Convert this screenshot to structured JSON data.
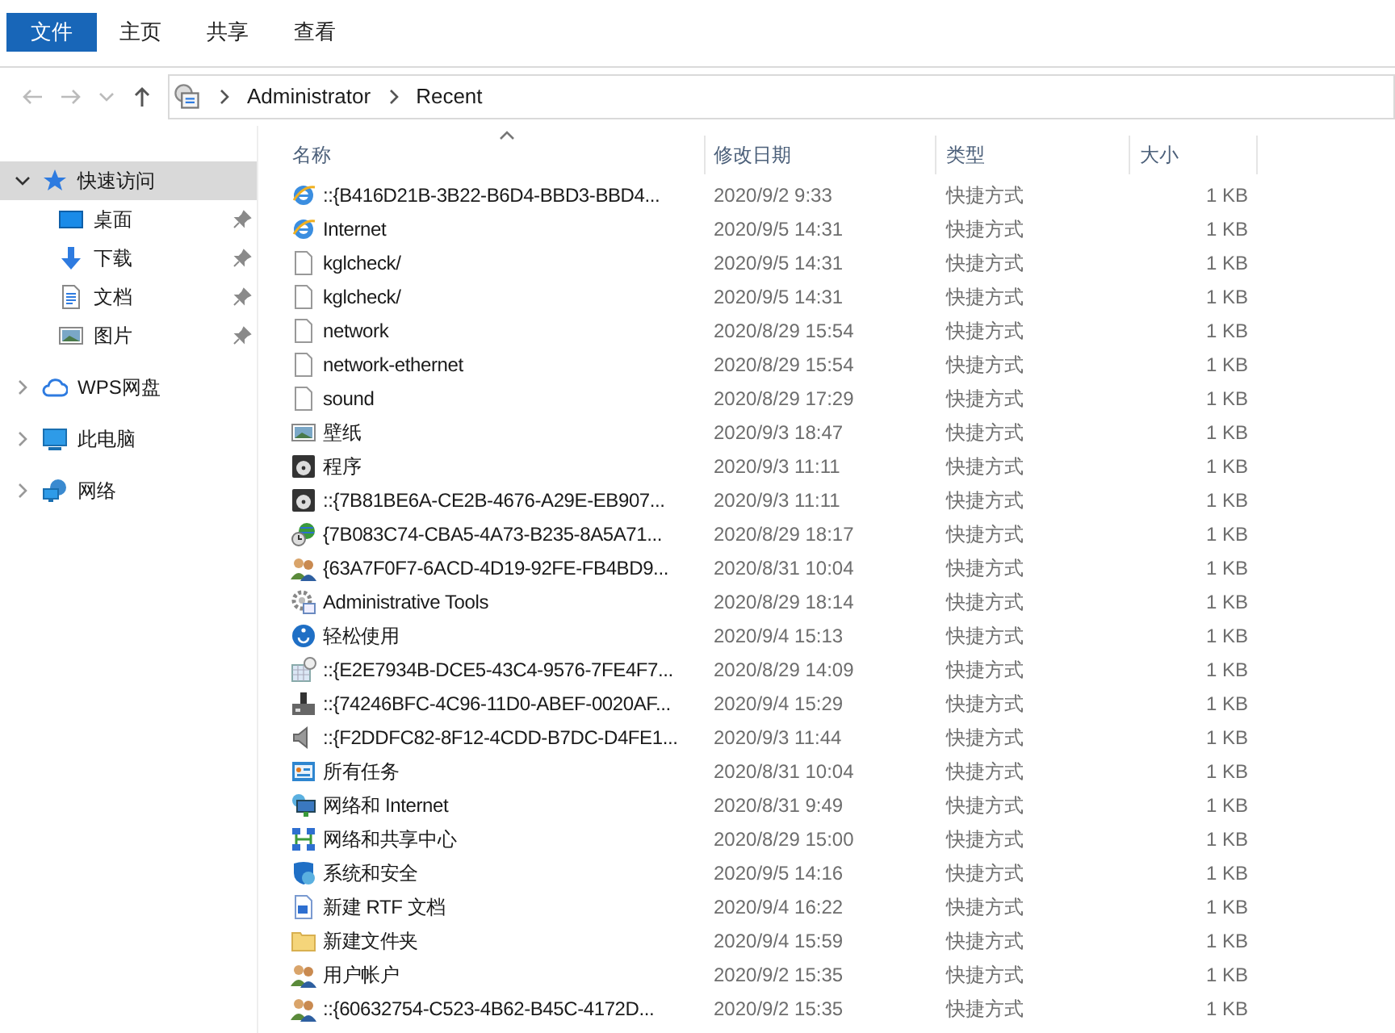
{
  "ribbon_tabs": [
    {
      "label": "文件",
      "selected": true
    },
    {
      "label": "主页",
      "selected": false
    },
    {
      "label": "共享",
      "selected": false
    },
    {
      "label": "查看",
      "selected": false
    }
  ],
  "address_bar": {
    "path": [
      "Administrator",
      "Recent"
    ]
  },
  "sidebar": {
    "items": [
      {
        "label": "快速访问",
        "kind": "star",
        "expanded": true,
        "selected": true,
        "children": [
          {
            "label": "桌面",
            "kind": "desktop",
            "pinned": true
          },
          {
            "label": "下载",
            "kind": "download",
            "pinned": true
          },
          {
            "label": "文档",
            "kind": "document",
            "pinned": true
          },
          {
            "label": "图片",
            "kind": "picture",
            "pinned": true
          }
        ]
      },
      {
        "label": "WPS网盘",
        "kind": "cloud",
        "expanded": false,
        "selected": false
      },
      {
        "label": "此电脑",
        "kind": "computer",
        "expanded": false,
        "selected": false
      },
      {
        "label": "网络",
        "kind": "network",
        "expanded": false,
        "selected": false
      }
    ]
  },
  "table": {
    "columns": [
      "名称",
      "修改日期",
      "类型",
      "大小"
    ],
    "rows": [
      {
        "kind": "browser",
        "name": "::{B416D21B-3B22-B6D4-BBD3-BBD4...",
        "date": "2020/9/2 9:33",
        "type": "快捷方式",
        "size": "1 KB"
      },
      {
        "kind": "browser",
        "name": "Internet",
        "date": "2020/9/5 14:31",
        "type": "快捷方式",
        "size": "1 KB"
      },
      {
        "kind": "file",
        "name": "kglcheck/",
        "date": "2020/9/5 14:31",
        "type": "快捷方式",
        "size": "1 KB"
      },
      {
        "kind": "file",
        "name": "kglcheck/",
        "date": "2020/9/5 14:31",
        "type": "快捷方式",
        "size": "1 KB"
      },
      {
        "kind": "file",
        "name": "network",
        "date": "2020/8/29 15:54",
        "type": "快捷方式",
        "size": "1 KB"
      },
      {
        "kind": "file",
        "name": "network-ethernet",
        "date": "2020/8/29 15:54",
        "type": "快捷方式",
        "size": "1 KB"
      },
      {
        "kind": "file",
        "name": "sound",
        "date": "2020/8/29 17:29",
        "type": "快捷方式",
        "size": "1 KB"
      },
      {
        "kind": "picture",
        "name": "壁纸",
        "date": "2020/9/3 18:47",
        "type": "快捷方式",
        "size": "1 KB"
      },
      {
        "kind": "disc",
        "name": "程序",
        "date": "2020/9/3 11:11",
        "type": "快捷方式",
        "size": "1 KB"
      },
      {
        "kind": "disc",
        "name": "::{7B81BE6A-CE2B-4676-A29E-EB907...",
        "date": "2020/9/3 11:11",
        "type": "快捷方式",
        "size": "1 KB"
      },
      {
        "kind": "globe",
        "name": "{7B083C74-CBA5-4A73-B235-8A5A71...",
        "date": "2020/8/29 18:17",
        "type": "快捷方式",
        "size": "1 KB"
      },
      {
        "kind": "users",
        "name": "{63A7F0F7-6ACD-4D19-92FE-FB4BD9...",
        "date": "2020/8/31 10:04",
        "type": "快捷方式",
        "size": "1 KB"
      },
      {
        "kind": "gear",
        "name": "Administrative Tools",
        "date": "2020/8/29 18:14",
        "type": "快捷方式",
        "size": "1 KB"
      },
      {
        "kind": "access",
        "name": "轻松使用",
        "date": "2020/9/4 15:13",
        "type": "快捷方式",
        "size": "1 KB"
      },
      {
        "kind": "calendar",
        "name": "::{E2E7934B-DCE5-43C4-9576-7FE4F7...",
        "date": "2020/8/29 14:09",
        "type": "快捷方式",
        "size": "1 KB"
      },
      {
        "kind": "device",
        "name": "::{74246BFC-4C96-11D0-ABEF-0020AF...",
        "date": "2020/9/4 15:29",
        "type": "快捷方式",
        "size": "1 KB"
      },
      {
        "kind": "speaker",
        "name": "::{F2DDFC82-8F12-4CDD-B7DC-D4FE1...",
        "date": "2020/9/3 11:44",
        "type": "快捷方式",
        "size": "1 KB"
      },
      {
        "kind": "panel",
        "name": "所有任务",
        "date": "2020/8/31 10:04",
        "type": "快捷方式",
        "size": "1 KB"
      },
      {
        "kind": "monitor",
        "name": "网络和 Internet",
        "date": "2020/8/31 9:49",
        "type": "快捷方式",
        "size": "1 KB"
      },
      {
        "kind": "grid",
        "name": "网络和共享中心",
        "date": "2020/8/29 15:00",
        "type": "快捷方式",
        "size": "1 KB"
      },
      {
        "kind": "shield",
        "name": "系统和安全",
        "date": "2020/9/5 14:16",
        "type": "快捷方式",
        "size": "1 KB"
      },
      {
        "kind": "rtf",
        "name": "新建 RTF 文档",
        "date": "2020/9/4 16:22",
        "type": "快捷方式",
        "size": "1 KB"
      },
      {
        "kind": "folder",
        "name": "新建文件夹",
        "date": "2020/9/4 15:59",
        "type": "快捷方式",
        "size": "1 KB"
      },
      {
        "kind": "users",
        "name": "用户帐户",
        "date": "2020/9/2 15:35",
        "type": "快捷方式",
        "size": "1 KB"
      },
      {
        "kind": "users",
        "name": "::{60632754-C523-4B62-B45C-4172D...",
        "date": "2020/9/2 15:35",
        "type": "快捷方式",
        "size": "1 KB"
      }
    ]
  }
}
